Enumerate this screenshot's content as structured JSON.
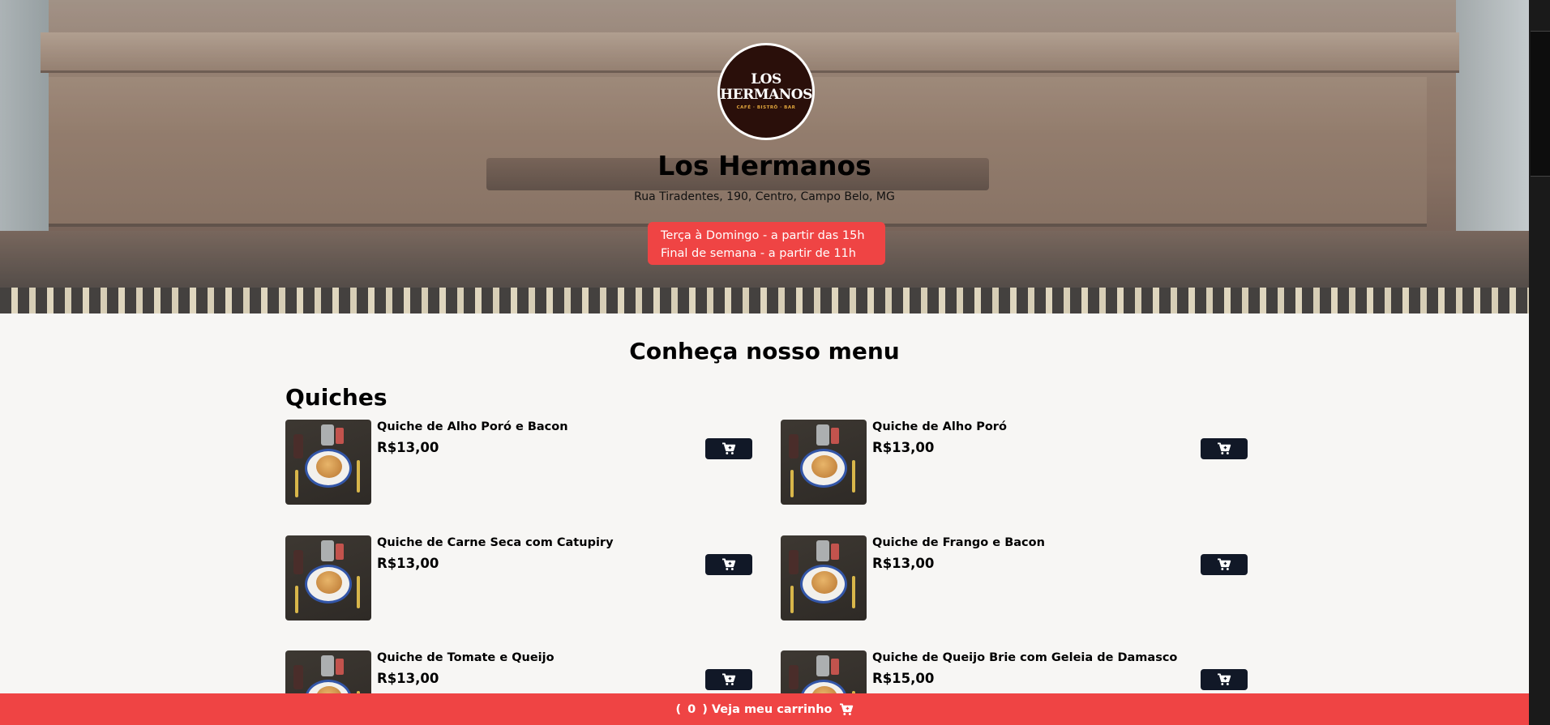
{
  "restaurant": {
    "logo": {
      "line1": "LOS",
      "line2": "HERMANOS",
      "tagline": "CAFÉ · BISTRÔ · BAR"
    },
    "name": "Los Hermanos",
    "address": "Rua Tiradentes, 190, Centro, Campo Belo, MG",
    "hours": [
      "Terça à Domingo - a partir das 15h",
      "Final de semana - a partir de 11h"
    ]
  },
  "menu": {
    "title": "Conheça nosso menu",
    "sections": [
      {
        "title": "Quiches",
        "items": [
          {
            "name": "Quiche de Alho Poró e Bacon",
            "price": "R$13,00"
          },
          {
            "name": "Quiche de Alho Poró",
            "price": "R$13,00"
          },
          {
            "name": "Quiche de Carne Seca com Catupiry",
            "price": "R$13,00"
          },
          {
            "name": "Quiche de Frango e Bacon",
            "price": "R$13,00"
          },
          {
            "name": "Quiche de Tomate e Queijo",
            "price": "R$13,00"
          },
          {
            "name": "Quiche de Queijo Brie com Geleia de Damasco",
            "price": "R$15,00"
          }
        ]
      }
    ]
  },
  "cart": {
    "open_paren": "(",
    "count": "0",
    "label": ") Veja meu carrinho"
  },
  "icons": {
    "add_to_cart": "cart-plus-icon",
    "cart": "cart-icon"
  },
  "colors": {
    "accent": "#ef4444",
    "button_dark": "#111827",
    "page_bg": "#f7f6f4"
  }
}
